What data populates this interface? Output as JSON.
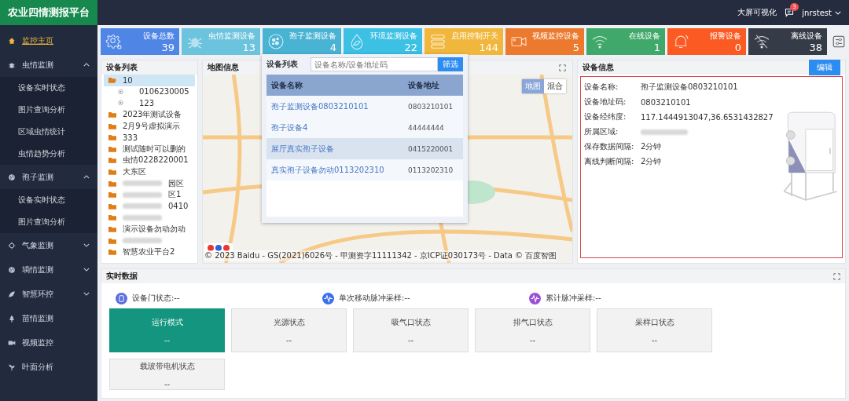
{
  "header": {
    "logo": "农业四情测报平台",
    "links": [
      {
        "label": "大屏可视化"
      }
    ],
    "messages_badge": "3",
    "user": "jnrstest"
  },
  "sidebar": {
    "items": [
      {
        "label": "监控主页",
        "selected": true
      },
      {
        "label": "虫情监测",
        "selected": false,
        "expanded": true,
        "children": [
          {
            "label": "设备实时状态"
          },
          {
            "label": "图片查询分析"
          },
          {
            "label": "区域虫情统计"
          },
          {
            "label": "虫情趋势分析"
          }
        ]
      },
      {
        "label": "孢子监测",
        "selected": false,
        "expanded": true,
        "children": [
          {
            "label": "设备实时状态"
          },
          {
            "label": "图片查询分析"
          }
        ]
      },
      {
        "label": "气象监测",
        "selected": false,
        "expanded": false
      },
      {
        "label": "墒情监测",
        "selected": false,
        "expanded": false
      },
      {
        "label": "智慧环控",
        "selected": false,
        "expanded": false
      },
      {
        "label": "苗情监测",
        "selected": false
      },
      {
        "label": "视频监控",
        "selected": false
      },
      {
        "label": "叶面分析",
        "selected": false
      }
    ]
  },
  "stats": [
    {
      "label": "设备总数",
      "value": "39",
      "kind": "gear",
      "color": "#4f86e6"
    },
    {
      "label": "虫情监测设备",
      "value": "13",
      "kind": "bug",
      "color": "#6cc3dd"
    },
    {
      "label": "孢子监测设备",
      "value": "4",
      "kind": "spore",
      "color": "#49b3d3"
    },
    {
      "label": "环境监测设备",
      "value": "22",
      "kind": "drop",
      "color": "#3cc0e4"
    },
    {
      "label": "启用控制开关",
      "value": "144",
      "kind": "list",
      "color": "#f1b73c"
    },
    {
      "label": "视频监控设备",
      "value": "5",
      "kind": "camera",
      "color": "#ec7a2e"
    },
    {
      "label": "在线设备",
      "value": "1",
      "kind": "wifi",
      "color": "#3fa86a"
    },
    {
      "label": "报警设备",
      "value": "0",
      "kind": "bell",
      "color": "#fb5a22"
    },
    {
      "label": "离线设备",
      "value": "38",
      "kind": "wifi-off",
      "color": "#363b48"
    }
  ],
  "device_list": {
    "title": "设备列表",
    "items": [
      {
        "label": "10",
        "kind": "folder-open",
        "selected": true,
        "blurred": false
      },
      {
        "label": "0106230005",
        "kind": "device",
        "selected": false,
        "blurred": false
      },
      {
        "label": "123",
        "kind": "device",
        "selected": false,
        "blurred": false
      },
      {
        "label": "2023年测试设备",
        "kind": "folder",
        "selected": false,
        "blurred": false
      },
      {
        "label": "2月9号虚拟演示",
        "kind": "folder",
        "selected": false,
        "blurred": false
      },
      {
        "label": "333",
        "kind": "folder",
        "selected": false,
        "blurred": false
      },
      {
        "label": "测试随时可以删的",
        "kind": "folder",
        "selected": false,
        "blurred": false
      },
      {
        "label": "虫情0228220001",
        "kind": "folder",
        "selected": false,
        "blurred": false
      },
      {
        "label": "大东区",
        "kind": "folder",
        "selected": false,
        "blurred": false
      },
      {
        "label": "园区",
        "kind": "folder",
        "selected": false,
        "blurred": true
      },
      {
        "label": "区1",
        "kind": "folder",
        "selected": false,
        "blurred": true
      },
      {
        "label": "0410",
        "kind": "folder",
        "selected": false,
        "blurred": true
      },
      {
        "kind": "folder",
        "selected": false,
        "blurred": true
      },
      {
        "label": "演示设备勿动勿动",
        "kind": "folder",
        "selected": false,
        "blurred": false
      },
      {
        "kind": "folder",
        "selected": false,
        "blurred": true
      },
      {
        "label": "智慧农业平台2",
        "kind": "folder",
        "selected": false,
        "blurred": false
      }
    ]
  },
  "map": {
    "title": "地图信息",
    "map_types": [
      {
        "label": "地图",
        "selected": true
      },
      {
        "label": "混合",
        "selected": false
      }
    ],
    "copyright": "© 2023 Baidu - GS(2021)6026号 - 甲测资字11111342 - 京ICP证030173号 - Data © 百度智图",
    "popup": {
      "title": "设备列表",
      "search": {
        "placeholder": "设备名称/设备地址码"
      },
      "filter_button": "筛选",
      "columns": [
        "设备名称",
        "设备地址"
      ],
      "rows": [
        {
          "name": "孢子监测设备0803210101",
          "address": "0803210101",
          "selected": false
        },
        {
          "name": "孢子设备4",
          "address": "44444444",
          "selected": false
        },
        {
          "name": "展厅真实孢子设备",
          "address": "0415220001",
          "selected": true
        },
        {
          "name": "真实孢子设备勿动0113202310",
          "address": "0113202310",
          "selected": false
        }
      ]
    }
  },
  "device_info": {
    "title": "设备信息",
    "edit_button": "编辑",
    "fields": [
      {
        "label": "设备名称:",
        "value": "孢子监测设备0803210101",
        "blurred": false
      },
      {
        "label": "设备地址码:",
        "value": "0803210101",
        "blurred": false
      },
      {
        "label": "设备经纬度:",
        "value": "117.1444913047,36.6531432827",
        "blurred": false
      },
      {
        "label": "所属区域:",
        "blurred": true
      },
      {
        "label": "保存数据间隔:",
        "value": "2分钟",
        "blurred": false
      },
      {
        "label": "离线判断间隔:",
        "value": "2分钟",
        "blurred": false
      }
    ]
  },
  "realtime": {
    "title": "实时数据",
    "indicators": [
      {
        "label": "设备门状态:",
        "value": "--",
        "kind": "door",
        "color": "#5a6ee0"
      },
      {
        "label": "单次移动脉冲采样:",
        "value": "--",
        "kind": "pulse",
        "color": "#3b6ff0"
      },
      {
        "label": "累计脉冲采样:",
        "value": "--",
        "kind": "pulse",
        "color": "#9c4fd8"
      }
    ],
    "tiles": [
      {
        "label": "运行模式",
        "value": "--",
        "selected": true
      },
      {
        "label": "光源状态",
        "value": "--",
        "selected": false
      },
      {
        "label": "吸气口状态",
        "value": "--",
        "selected": false
      },
      {
        "label": "排气口状态",
        "value": "--",
        "selected": false
      },
      {
        "label": "采样口状态",
        "value": "--",
        "selected": false
      },
      {
        "label": "载玻带电机状态",
        "value": "--",
        "selected": false
      }
    ]
  }
}
